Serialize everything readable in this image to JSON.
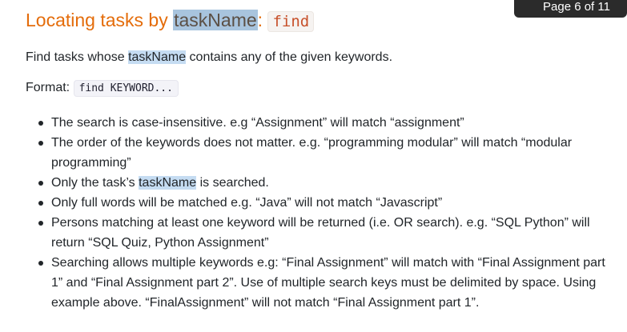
{
  "page_indicator": "Page 6 of 11",
  "heading": {
    "prefix": "Locating tasks by ",
    "highlight": "taskName",
    "suffix": ":",
    "code": "find"
  },
  "description": {
    "before": "Find tasks whose ",
    "highlight": "taskName",
    "after": " contains any of the given keywords."
  },
  "format": {
    "label": "Format: ",
    "code": "find KEYWORD..."
  },
  "bullets": [
    "The search is case-insensitive. e.g “Assignment” will match “assignment”",
    "The order of the keywords does not matter. e.g. “programming modular” will match “modular programming”",
    {
      "before": "Only the task’s ",
      "highlight": "taskName",
      "after": " is searched."
    },
    "Only full words will be matched e.g. “Java” will not match “Javascript”",
    "Persons matching at least one keyword will be returned (i.e. OR search). e.g. “SQL Python” will return “SQL Quiz, Python Assignment”",
    "Searching allows multiple keywords e.g: “Final Assignment” will match with “Final Assignment part 1” and “Final Assignment part 2”. Use of multiple search keys must be delimited by space. Using example above. “FinalAssignment” will not match “Final Assignment part 1”."
  ],
  "colors": {
    "heading": "#e46c0a",
    "highlight_strong": "#a8c4de",
    "highlight": "#c5dcf2",
    "page_indicator_bg": "#2b2b2b"
  }
}
